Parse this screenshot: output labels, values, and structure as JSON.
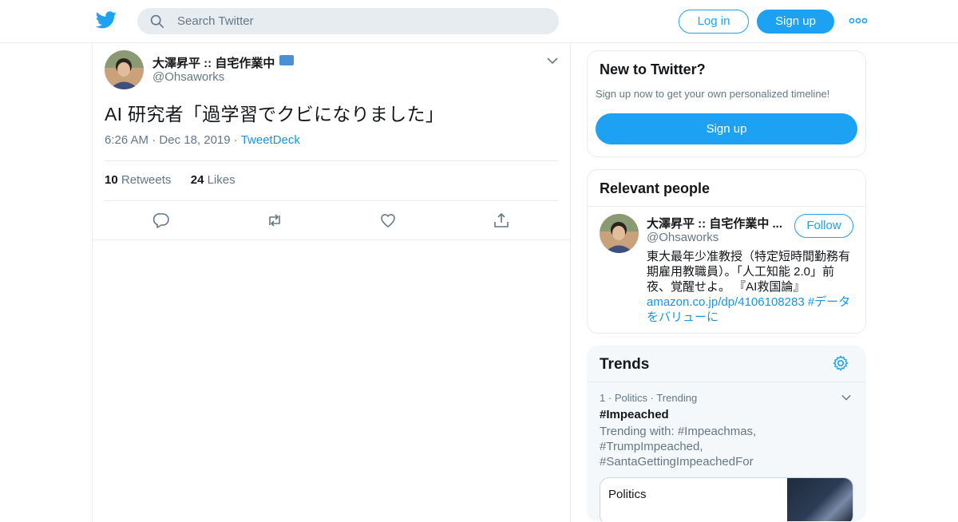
{
  "header": {
    "search_placeholder": "Search Twitter",
    "login_label": "Log in",
    "signup_label": "Sign up"
  },
  "tweet": {
    "author_name": "大澤昇平 :: 自宅作業中",
    "author_handle": "@Ohsaworks",
    "text": "AI 研究者「過学習でクビになりました」",
    "time": "6:26 AM",
    "date": "Dec 18, 2019",
    "source": "TweetDeck",
    "retweets_count": "10",
    "retweets_label": "Retweets",
    "likes_count": "24",
    "likes_label": "Likes"
  },
  "new_to_twitter": {
    "title": "New to Twitter?",
    "subtitle": "Sign up now to get your own personalized timeline!",
    "signup_label": "Sign up"
  },
  "relevant_people": {
    "title": "Relevant people",
    "name": "大澤昇平 :: 自宅作業中 ...",
    "handle": "@Ohsaworks",
    "follow_label": "Follow",
    "bio_text": "東大最年少准教授（特定短時間勤務有期雇用教職員）。「人工知能 2.0」前夜、覚醒せよ。 『AI救国論』",
    "bio_link": "amazon.co.jp/dp/4106108283",
    "bio_hashtag": "#データをバリューに"
  },
  "trends": {
    "title": "Trends",
    "items": [
      {
        "rank": "1",
        "category": "Politics",
        "status": "Trending",
        "name": "#Impeached",
        "trending_with": "Trending with: #Impeachmas, #TrumpImpeached, #SantaGettingImpeachedFor",
        "card_label": "Politics"
      }
    ]
  },
  "colors": {
    "accent": "#1da1f2",
    "link": "#1b95e0",
    "muted": "#657786",
    "border": "#e6ecf0"
  }
}
